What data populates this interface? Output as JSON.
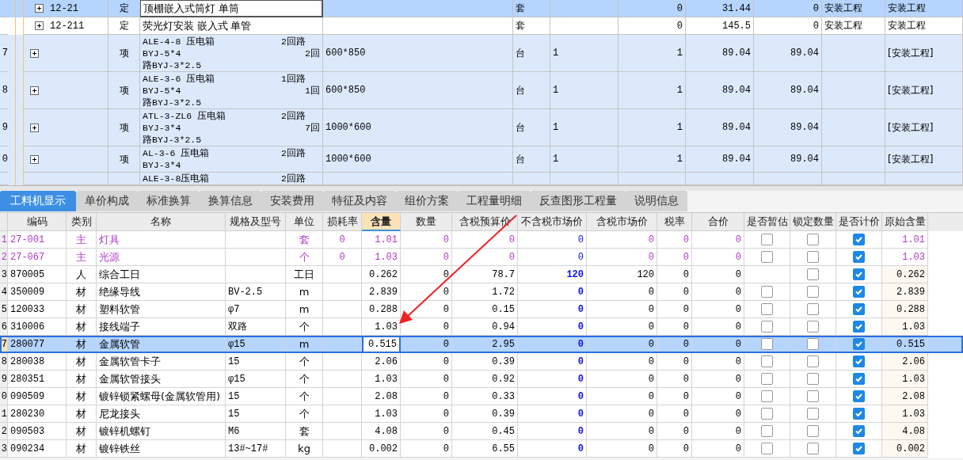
{
  "quota_grid": {
    "rows": [
      {
        "kind": "quota",
        "index": "",
        "expandable": true,
        "code": "12-21",
        "type": "定",
        "name_lines": [
          {
            "text": "顶棚嵌入式筒灯 单筒"
          }
        ],
        "spec": "",
        "unit": "套",
        "column_8": "",
        "column_9": "0",
        "column_10": "31.44",
        "column_11": "0",
        "column_12": "安装工程",
        "column_13": "安装工程",
        "selected": true
      },
      {
        "kind": "quota",
        "index": "",
        "expandable": true,
        "code": "12-211",
        "type": "定",
        "name_lines": [
          {
            "text": "荧光灯安装 嵌入式 单管"
          }
        ],
        "spec": "",
        "unit": "套",
        "column_8": "",
        "column_9": "0",
        "column_10": "145.5",
        "column_11": "0",
        "column_12": "安装工程",
        "column_13": "安装工程",
        "selected": false
      },
      {
        "kind": "item",
        "index": "7",
        "expandable": true,
        "code": "",
        "type": "项",
        "name_lines": [
          {
            "text": "ALE-4-8 压电箱",
            "tail": "2回路"
          },
          {
            "text": "BYJ-5*4",
            "tail": "2回"
          },
          {
            "text": "路BYJ-3*2.5"
          }
        ],
        "spec": "600*850",
        "unit": "台",
        "column_8": "1",
        "column_9": "1",
        "column_10": "89.04",
        "column_11": "89.04",
        "column_12": "",
        "column_13": "[安装工程]",
        "selected": false
      },
      {
        "kind": "item",
        "index": "8",
        "expandable": true,
        "code": "",
        "type": "项",
        "name_lines": [
          {
            "text": "ALE-3-6 压电箱",
            "tail": "1回路"
          },
          {
            "text": "BYJ-5*4",
            "tail": "1回"
          },
          {
            "text": "路BYJ-3*2.5"
          }
        ],
        "spec": "600*850",
        "unit": "台",
        "column_8": "1",
        "column_9": "1",
        "column_10": "89.04",
        "column_11": "89.04",
        "column_12": "",
        "column_13": "[安装工程]",
        "selected": false
      },
      {
        "kind": "item",
        "index": "9",
        "expandable": true,
        "code": "",
        "type": "项",
        "name_lines": [
          {
            "text": "ATL-3-ZL6 压电箱",
            "tail": "2回路"
          },
          {
            "text": "BYJ-3*4",
            "tail": "7回"
          },
          {
            "text": "路BYJ-3*2.5"
          }
        ],
        "spec": "1000*600",
        "unit": "台",
        "column_8": "1",
        "column_9": "1",
        "column_10": "89.04",
        "column_11": "89.04",
        "column_12": "",
        "column_13": "[安装工程]",
        "selected": false
      },
      {
        "kind": "item",
        "index": "0",
        "expandable": true,
        "code": "",
        "type": "项",
        "name_lines": [
          {
            "text": "AL-3-6 压电箱",
            "tail": "2回路"
          },
          {
            "text": "BYJ-3*4"
          }
        ],
        "spec": "1000*600",
        "unit": "台",
        "column_8": "1",
        "column_9": "1",
        "column_10": "89.04",
        "column_11": "89.04",
        "column_12": "",
        "column_13": "[安装工程]",
        "selected": false
      },
      {
        "kind": "partial",
        "index": "",
        "expandable": false,
        "code": "",
        "type": "",
        "name_lines": [
          {
            "text": "ALE-3-8压电箱",
            "tail": "2回路"
          }
        ],
        "spec": "",
        "unit": "",
        "column_8": "",
        "column_9": "",
        "column_10": "",
        "column_11": "",
        "column_12": "",
        "column_13": "",
        "selected": false
      }
    ]
  },
  "tabs": [
    {
      "label": "工料机显示",
      "selected": true
    },
    {
      "label": "单价构成",
      "selected": false
    },
    {
      "label": "标准换算",
      "selected": false
    },
    {
      "label": "换算信息",
      "selected": false
    },
    {
      "label": "安装费用",
      "selected": false
    },
    {
      "label": "特征及内容",
      "selected": false
    },
    {
      "label": "组价方案",
      "selected": false
    },
    {
      "label": "工程量明细",
      "selected": false
    },
    {
      "label": "反查图形工程量",
      "selected": false
    },
    {
      "label": "说明信息",
      "selected": false
    }
  ],
  "material_table": {
    "columns": [
      {
        "label": "编码",
        "sorted": false
      },
      {
        "label": "类别",
        "sorted": false
      },
      {
        "label": "名称",
        "sorted": false
      },
      {
        "label": "规格及型号",
        "sorted": false
      },
      {
        "label": "单位",
        "sorted": false
      },
      {
        "label": "损耗率",
        "sorted": false
      },
      {
        "label": "含量",
        "sorted": true
      },
      {
        "label": "数量",
        "sorted": false
      },
      {
        "label": "含税预算价",
        "sorted": false
      },
      {
        "label": "不含税市场价",
        "sorted": false
      },
      {
        "label": "含税市场价",
        "sorted": false
      },
      {
        "label": "税率",
        "sorted": false
      },
      {
        "label": "合价",
        "sorted": false
      },
      {
        "label": "是否暂估",
        "sorted": false
      },
      {
        "label": "锁定数量",
        "sorted": false
      },
      {
        "label": "是否计价",
        "sorted": false
      },
      {
        "label": "原始含量",
        "sorted": false
      }
    ],
    "rows": [
      {
        "kind": "main",
        "index": "1",
        "code": "27-001",
        "category": "主",
        "name": "灯具",
        "spec": "",
        "unit": "套",
        "loss_rate": "0",
        "content": "1.01",
        "quantity": "0",
        "tax_budget_price": "0",
        "market_price_ex_tax": "0",
        "market_price_tax": "0",
        "tax_rate": "0",
        "total": "0",
        "estimated": false,
        "locked": false,
        "priced": true,
        "original_content": "1.01",
        "selected": false
      },
      {
        "kind": "main",
        "index": "2",
        "code": "27-067",
        "category": "主",
        "name": "光源",
        "spec": "",
        "unit": "个",
        "loss_rate": "0",
        "content": "1.03",
        "quantity": "0",
        "tax_budget_price": "0",
        "market_price_ex_tax": "0",
        "market_price_tax": "0",
        "tax_rate": "0",
        "total": "0",
        "estimated": false,
        "locked": false,
        "priced": true,
        "original_content": "1.03",
        "selected": false
      },
      {
        "kind": "labor",
        "index": "3",
        "code": "870005",
        "category": "人",
        "name": "综合工日",
        "spec": "",
        "unit": "工日",
        "loss_rate": "",
        "content": "0.262",
        "quantity": "0",
        "tax_budget_price": "78.7",
        "market_price_ex_tax": "120",
        "market_price_tax": "120",
        "tax_rate": "0",
        "total": "0",
        "estimated": null,
        "locked": false,
        "priced": true,
        "original_content": "0.262",
        "selected": false
      },
      {
        "kind": "material",
        "index": "4",
        "code": "350009",
        "category": "材",
        "name": "绝缘导线",
        "spec": "BV-2.5",
        "unit": "m",
        "loss_rate": "",
        "content": "2.839",
        "quantity": "0",
        "tax_budget_price": "1.72",
        "market_price_ex_tax": "0",
        "market_price_tax": "0",
        "tax_rate": "0",
        "total": "0",
        "estimated": false,
        "locked": false,
        "priced": true,
        "original_content": "2.839",
        "selected": false
      },
      {
        "kind": "material",
        "index": "5",
        "code": "120033",
        "category": "材",
        "name": "塑料软管",
        "spec": "φ7",
        "unit": "m",
        "loss_rate": "",
        "content": "0.288",
        "quantity": "0",
        "tax_budget_price": "0.15",
        "market_price_ex_tax": "0",
        "market_price_tax": "0",
        "tax_rate": "0",
        "total": "0",
        "estimated": false,
        "locked": false,
        "priced": true,
        "original_content": "0.288",
        "selected": false
      },
      {
        "kind": "material",
        "index": "6",
        "code": "310006",
        "category": "材",
        "name": "接线端子",
        "spec": "双路",
        "unit": "个",
        "loss_rate": "",
        "content": "1.03",
        "quantity": "0",
        "tax_budget_price": "0.94",
        "market_price_ex_tax": "0",
        "market_price_tax": "0",
        "tax_rate": "0",
        "total": "0",
        "estimated": false,
        "locked": false,
        "priced": true,
        "original_content": "1.03",
        "selected": false
      },
      {
        "kind": "material",
        "index": "7",
        "code": "280077",
        "category": "材",
        "name": "金属软管",
        "spec": "φ15",
        "unit": "m",
        "loss_rate": "",
        "content": "0.515",
        "quantity": "0",
        "tax_budget_price": "2.95",
        "market_price_ex_tax": "0",
        "market_price_tax": "0",
        "tax_rate": "0",
        "total": "0",
        "estimated": false,
        "locked": false,
        "priced": true,
        "original_content": "0.515",
        "selected": true
      },
      {
        "kind": "material",
        "index": "8",
        "code": "280038",
        "category": "材",
        "name": "金属软管卡子",
        "spec": "15",
        "unit": "个",
        "loss_rate": "",
        "content": "2.06",
        "quantity": "0",
        "tax_budget_price": "0.39",
        "market_price_ex_tax": "0",
        "market_price_tax": "0",
        "tax_rate": "0",
        "total": "0",
        "estimated": false,
        "locked": false,
        "priced": true,
        "original_content": "2.06",
        "selected": false
      },
      {
        "kind": "material",
        "index": "9",
        "code": "280351",
        "category": "材",
        "name": "金属软管接头",
        "spec": "φ15",
        "unit": "个",
        "loss_rate": "",
        "content": "1.03",
        "quantity": "0",
        "tax_budget_price": "0.92",
        "market_price_ex_tax": "0",
        "market_price_tax": "0",
        "tax_rate": "0",
        "total": "0",
        "estimated": false,
        "locked": false,
        "priced": true,
        "original_content": "1.03",
        "selected": false
      },
      {
        "kind": "material",
        "index": "0",
        "code": "090509",
        "category": "材",
        "name": "镀锌锁紧螺母(金属软管用)",
        "spec": "15",
        "unit": "个",
        "loss_rate": "",
        "content": "2.08",
        "quantity": "0",
        "tax_budget_price": "0.33",
        "market_price_ex_tax": "0",
        "market_price_tax": "0",
        "tax_rate": "0",
        "total": "0",
        "estimated": false,
        "locked": false,
        "priced": true,
        "original_content": "2.08",
        "selected": false
      },
      {
        "kind": "material",
        "index": "1",
        "code": "280230",
        "category": "材",
        "name": "尼龙接头",
        "spec": "15",
        "unit": "个",
        "loss_rate": "",
        "content": "1.03",
        "quantity": "0",
        "tax_budget_price": "0.39",
        "market_price_ex_tax": "0",
        "market_price_tax": "0",
        "tax_rate": "0",
        "total": "0",
        "estimated": false,
        "locked": false,
        "priced": true,
        "original_content": "1.03",
        "selected": false
      },
      {
        "kind": "material",
        "index": "2",
        "code": "090503",
        "category": "材",
        "name": "镀锌机螺钉",
        "spec": "M6",
        "unit": "套",
        "loss_rate": "",
        "content": "4.08",
        "quantity": "0",
        "tax_budget_price": "0.45",
        "market_price_ex_tax": "0",
        "market_price_tax": "0",
        "tax_rate": "0",
        "total": "0",
        "estimated": false,
        "locked": false,
        "priced": true,
        "original_content": "4.08",
        "selected": false
      },
      {
        "kind": "material",
        "index": "3",
        "code": "090234",
        "category": "材",
        "name": "镀锌铁丝",
        "spec": "13#~17#",
        "unit": "kg",
        "loss_rate": "",
        "content": "0.002",
        "quantity": "0",
        "tax_budget_price": "6.55",
        "market_price_ex_tax": "0",
        "market_price_tax": "0",
        "tax_rate": "0",
        "total": "0",
        "estimated": false,
        "locked": false,
        "priced": true,
        "original_content": "0.002",
        "selected": false
      }
    ]
  }
}
